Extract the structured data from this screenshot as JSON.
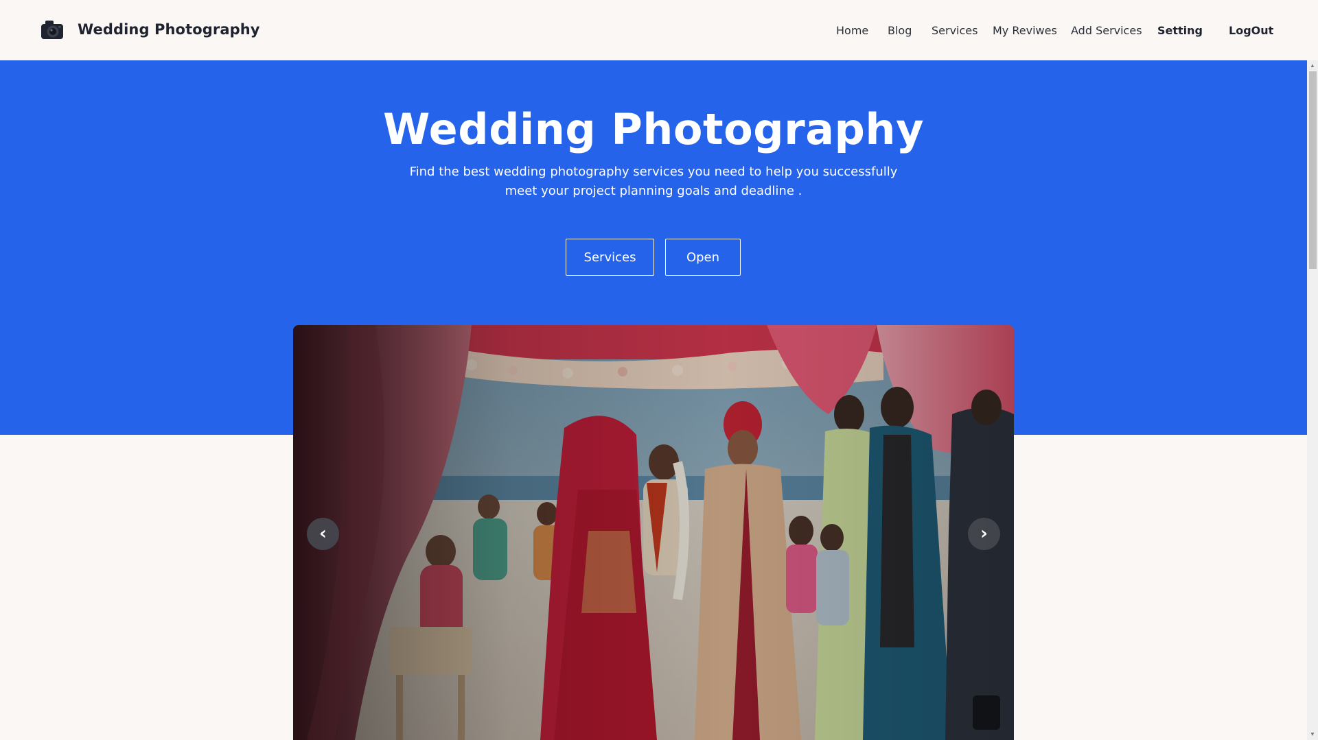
{
  "navbar": {
    "brand": "Wedding Photography",
    "brand_icon": "camera-icon",
    "links": [
      {
        "label": "Home"
      },
      {
        "label": "Blog"
      },
      {
        "label": "Services"
      },
      {
        "label": "My Reviwes"
      },
      {
        "label": "Add Services"
      },
      {
        "label": "Setting"
      },
      {
        "label": "LogOut"
      }
    ]
  },
  "hero": {
    "title": "Wedding Photography",
    "subtitle": "Find the best wedding photography services you need to help you successfully meet your project planning goals and deadline .",
    "buttons": {
      "services": "Services",
      "open": "Open"
    },
    "background_color": "#2563eb"
  },
  "carousel": {
    "prev_label": "‹",
    "next_label": "›",
    "prev_icon": "chevron-left-icon",
    "next_icon": "chevron-right-icon"
  }
}
